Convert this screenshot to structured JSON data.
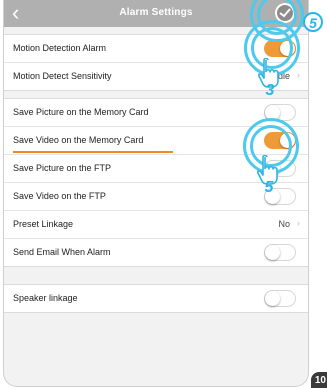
{
  "header": {
    "title": "Alarm Settings",
    "back_icon": "chevron-left-icon",
    "save_icon": "save-icon"
  },
  "group1": [
    {
      "label": "Motion Detection Alarm",
      "type": "toggle",
      "on": true
    },
    {
      "label": "Motion Detect Sensitivity",
      "type": "value",
      "value": "Middle"
    }
  ],
  "group2": [
    {
      "label": "Save Picture on the Memory Card",
      "type": "toggle",
      "on": false
    },
    {
      "label": "Save Video on the Memory Card",
      "type": "toggle",
      "on": true
    },
    {
      "label": "Save Picture on the FTP",
      "type": "toggle",
      "on": false
    },
    {
      "label": "Save Video on the FTP",
      "type": "toggle",
      "on": false
    },
    {
      "label": "Preset Linkage",
      "type": "value",
      "value": "No"
    },
    {
      "label": "Send Email When Alarm",
      "type": "toggle",
      "on": false
    }
  ],
  "group3": [
    {
      "label": "Speaker linkage",
      "type": "toggle",
      "on": false
    }
  ],
  "steps": {
    "save_step": "5",
    "motion_step": "3",
    "video_step": "5"
  },
  "page_number": "10",
  "colors": {
    "toggle_on": "#ee9a37",
    "highlight": "#4cc9ef",
    "underline": "#ee8b1c"
  }
}
